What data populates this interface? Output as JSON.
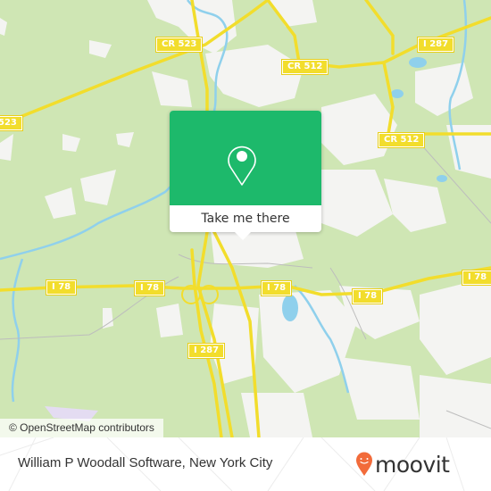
{
  "map": {
    "road_labels": [
      {
        "id": "cr523-top",
        "text": "CR 523"
      },
      {
        "id": "cr523-left",
        "text": "523"
      },
      {
        "id": "cr512-top",
        "text": "CR 512"
      },
      {
        "id": "cr512-right",
        "text": "CR 512"
      },
      {
        "id": "i287-top",
        "text": "I 287"
      },
      {
        "id": "i78-1",
        "text": "I 78"
      },
      {
        "id": "i78-2",
        "text": "I 78"
      },
      {
        "id": "i78-3",
        "text": "I 78"
      },
      {
        "id": "i78-4",
        "text": "I 78"
      },
      {
        "id": "i78-5",
        "text": "I 78"
      },
      {
        "id": "i287-bottom",
        "text": "I 287"
      }
    ],
    "colors": {
      "land": "#cfe6b4",
      "urban": "#f4f4f2",
      "water": "#8fd0ec",
      "highway": "#f2dd2c",
      "popup_green": "#1db96b"
    }
  },
  "popup": {
    "icon": "location-pin-icon",
    "button_label": "Take me there"
  },
  "attribution": "© OpenStreetMap contributors",
  "footer": {
    "title": "William P Woodall Software, New York City",
    "brand": "moovit",
    "brand_icon": "moovit-pin-logo-icon",
    "brand_color": "#f26b3a"
  }
}
